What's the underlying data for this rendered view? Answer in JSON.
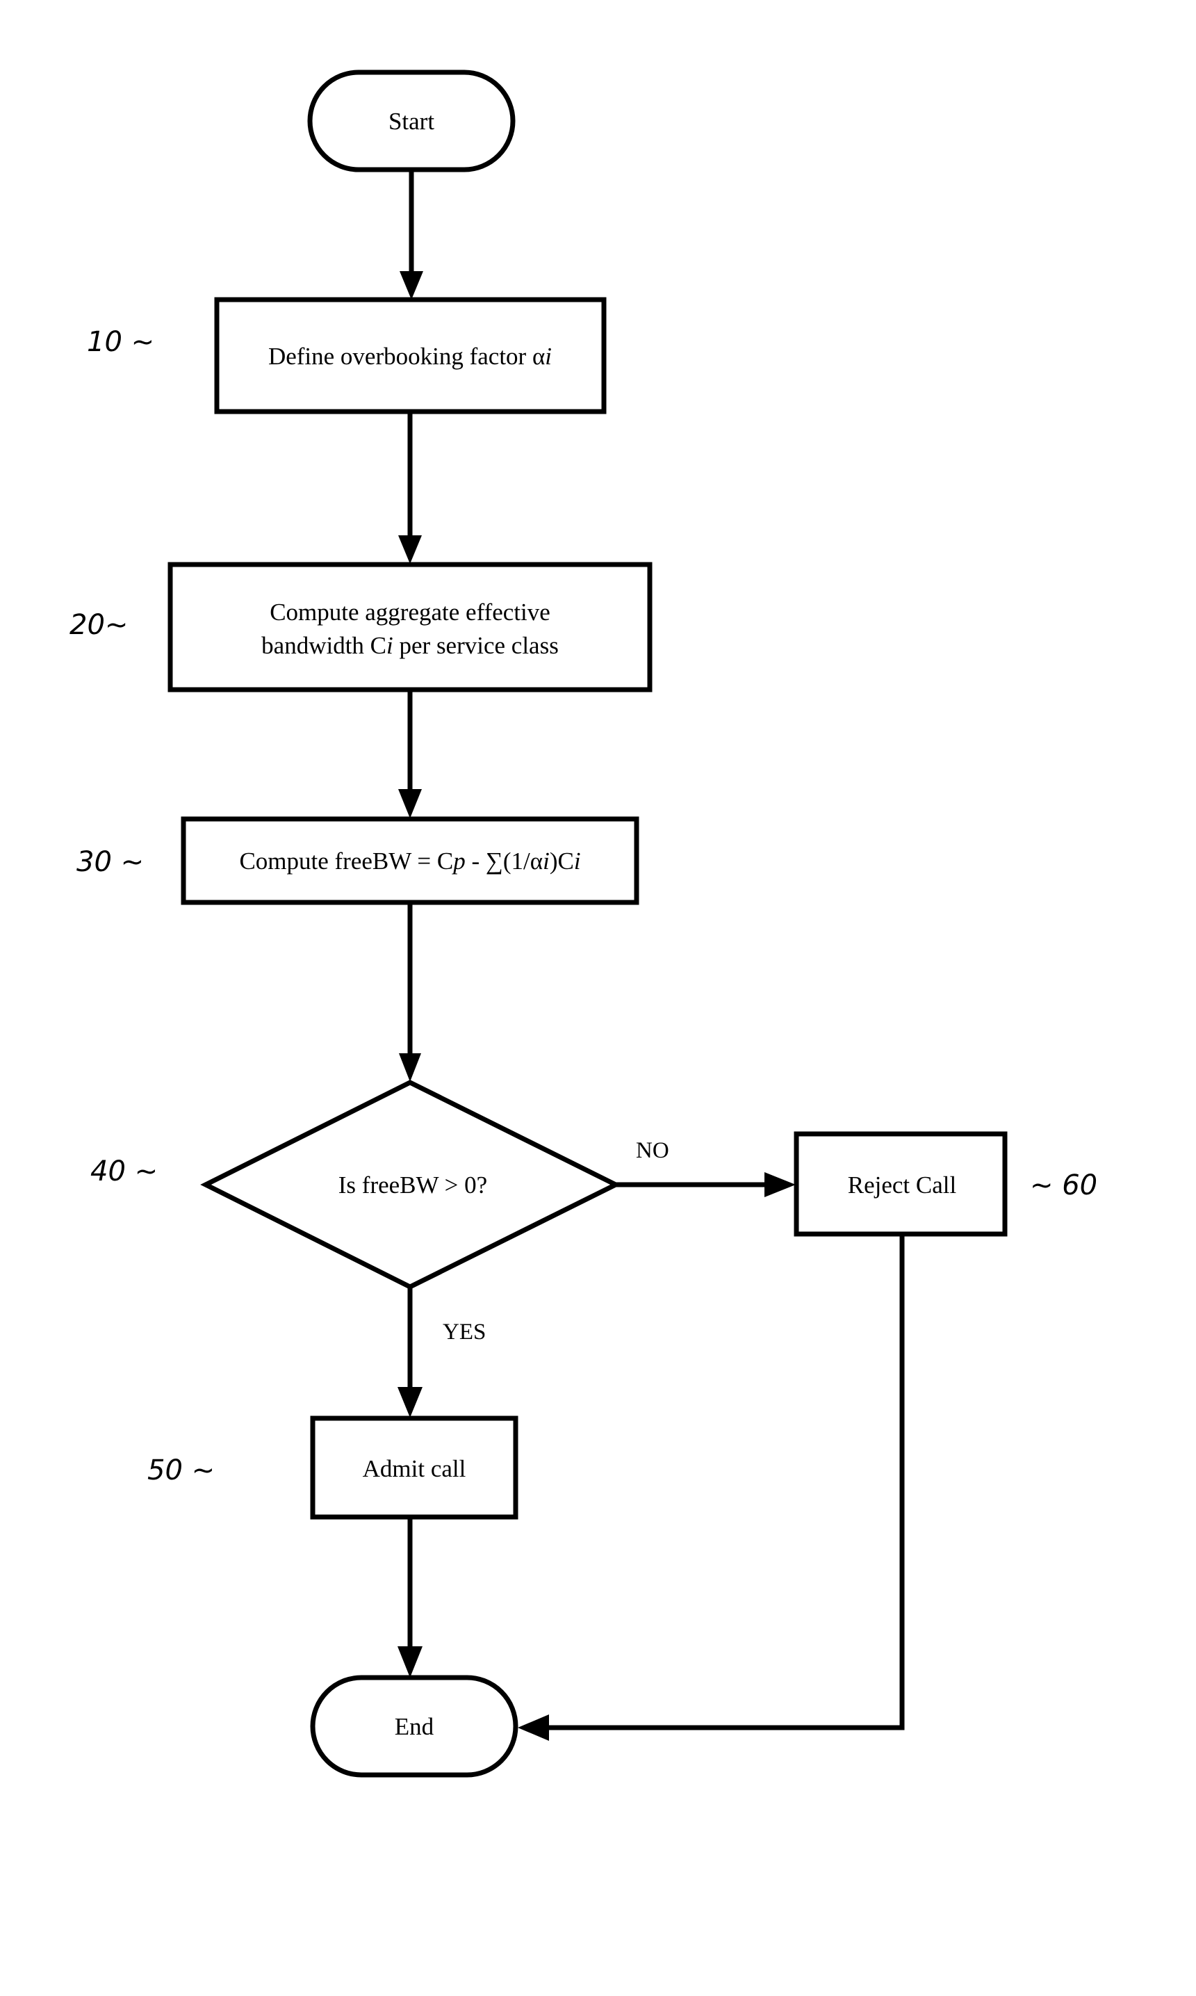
{
  "diagram": {
    "type": "flowchart",
    "nodes": [
      {
        "id": "start",
        "kind": "terminal",
        "label": "Start",
        "ref": ""
      },
      {
        "id": "define",
        "kind": "process",
        "label": "Define overbooking factor αi",
        "ref": "10"
      },
      {
        "id": "compute_ci",
        "kind": "process",
        "label_lines": [
          "Compute aggregate effective",
          "bandwidth Ci per service class"
        ],
        "ref": "20"
      },
      {
        "id": "compute_free",
        "kind": "process",
        "label": "Compute freeBW = Cp - ∑(1/αi)Ci",
        "ref": "30"
      },
      {
        "id": "decision",
        "kind": "decision",
        "label": "Is freeBW > 0?",
        "ref": "40"
      },
      {
        "id": "admit",
        "kind": "process",
        "label": "Admit call",
        "ref": "50"
      },
      {
        "id": "reject",
        "kind": "process",
        "label": "Reject Call",
        "ref": "60"
      },
      {
        "id": "end",
        "kind": "terminal",
        "label": "End",
        "ref": ""
      }
    ],
    "edges": [
      {
        "from": "start",
        "to": "define",
        "label": ""
      },
      {
        "from": "define",
        "to": "compute_ci",
        "label": ""
      },
      {
        "from": "compute_ci",
        "to": "compute_free",
        "label": ""
      },
      {
        "from": "compute_free",
        "to": "decision",
        "label": ""
      },
      {
        "from": "decision",
        "to": "reject",
        "label": "NO"
      },
      {
        "from": "decision",
        "to": "admit",
        "label": "YES"
      },
      {
        "from": "admit",
        "to": "end",
        "label": ""
      },
      {
        "from": "reject",
        "to": "end",
        "label": ""
      }
    ],
    "ref_labels": {
      "r10": "10 ~",
      "r20": "20~",
      "r30": "30 ~",
      "r40": "40 ~",
      "r50": "50 ~",
      "r60": "~ 60"
    },
    "text": {
      "start": "Start",
      "define_main": "Define overbooking factor α",
      "define_sub": "i",
      "ci_line1": "Compute aggregate effective",
      "ci_line2a": "bandwidth C",
      "ci_line2b": "i",
      "ci_line2c": " per service class",
      "free_a": "Compute freeBW = C",
      "free_b": "p",
      "free_c": " - ∑(1/α",
      "free_d": "i",
      "free_e": ")C",
      "free_f": "i",
      "decision": "Is freeBW > 0?",
      "admit": "Admit call",
      "reject": "Reject Call",
      "end": "End",
      "no": "NO",
      "yes": "YES"
    }
  }
}
